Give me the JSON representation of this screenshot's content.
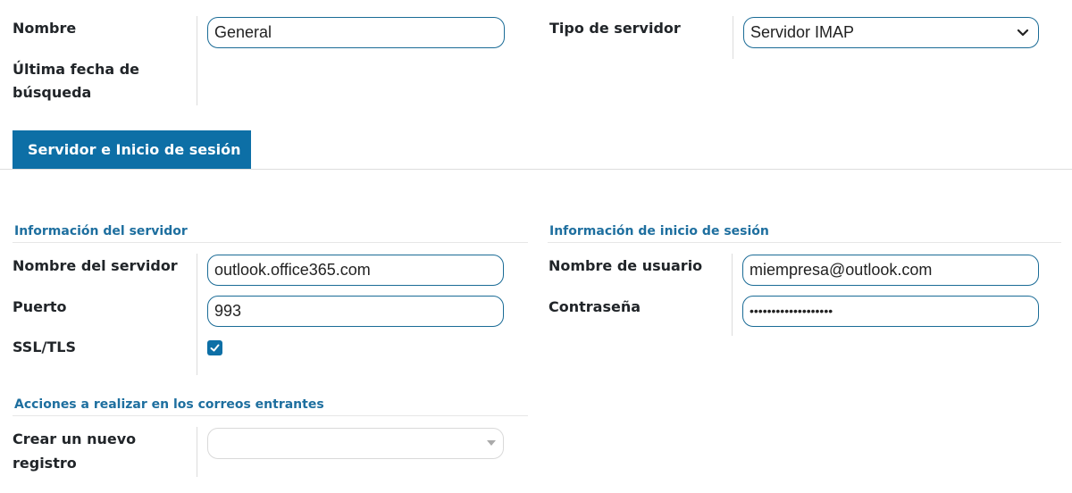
{
  "top": {
    "nombre_label": "Nombre",
    "nombre_value": "General",
    "ultima_label_line1": "Última fecha de",
    "ultima_label_line2": "búsqueda",
    "tipo_label": "Tipo de servidor",
    "tipo_value": "Servidor IMAP"
  },
  "tabs": [
    {
      "label": "Servidor e Inicio de sesión",
      "active": true
    }
  ],
  "server_info": {
    "section_title": "Información del servidor",
    "nombre_servidor_label": "Nombre del servidor",
    "nombre_servidor_value": "outlook.office365.com",
    "puerto_label": "Puerto",
    "puerto_value": "993",
    "ssl_label": "SSL/TLS",
    "ssl_checked": true
  },
  "login_info": {
    "section_title": "Información de inicio de sesión",
    "usuario_label": "Nombre de usuario",
    "usuario_value": "miempresa@outlook.com",
    "contrasena_label": "Contraseña",
    "contrasena_value": "•••••••••••••••••••"
  },
  "actions": {
    "section_title": "Acciones a realizar en los correos entrantes",
    "crear_label_line1": "Crear un nuevo",
    "crear_label_line2": "registro",
    "crear_value": ""
  },
  "colors": {
    "accent": "#0d6fa6",
    "section_title": "#1e6f9f",
    "input_border": "#1a6b96"
  }
}
